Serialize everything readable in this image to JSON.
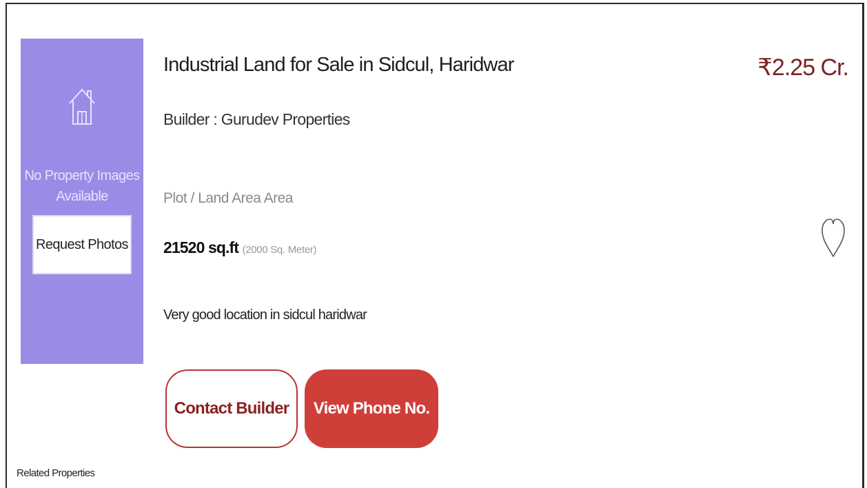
{
  "listing": {
    "image_placeholder": {
      "icon": "house-icon",
      "text_line1": "No Property Images",
      "text_line2": "Available",
      "request_button_label": "Request Photos",
      "background_color": "#9b8be6"
    },
    "title": "Industrial Land for Sale in Sidcul, Haridwar",
    "builder": "Builder : Gurudev Properties",
    "price": "₹2.25 Cr.",
    "area_label": "Plot / Land Area Area",
    "area_value": "21520 sq.ft",
    "area_alt": "(2000 Sq. Meter)",
    "description": "Very good location in sidcul haridwar",
    "favorite_icon": "heart-outline-icon",
    "contact_button_label": "Contact Builder",
    "phone_button_label": "View Phone No.",
    "accent_color": "#cf3f3a",
    "price_color": "#7a2222"
  },
  "related": {
    "label": "Related Properties"
  }
}
